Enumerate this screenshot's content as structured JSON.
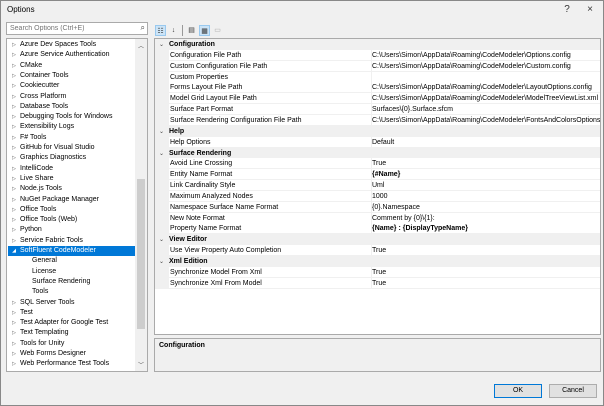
{
  "window": {
    "title": "Options",
    "help": "?",
    "close": "×"
  },
  "search": {
    "placeholder": "Search Options (Ctrl+E)"
  },
  "tree": [
    {
      "label": "Azure Dev Spaces Tools"
    },
    {
      "label": "Azure Service Authentication"
    },
    {
      "label": "CMake"
    },
    {
      "label": "Container Tools"
    },
    {
      "label": "Cookiecutter"
    },
    {
      "label": "Cross Platform"
    },
    {
      "label": "Database Tools"
    },
    {
      "label": "Debugging Tools for Windows"
    },
    {
      "label": "Extensibility Logs"
    },
    {
      "label": "F# Tools"
    },
    {
      "label": "GitHub for Visual Studio"
    },
    {
      "label": "Graphics Diagnostics"
    },
    {
      "label": "IntelliCode"
    },
    {
      "label": "Live Share"
    },
    {
      "label": "Node.js Tools"
    },
    {
      "label": "NuGet Package Manager"
    },
    {
      "label": "Office Tools"
    },
    {
      "label": "Office Tools (Web)"
    },
    {
      "label": "Python"
    },
    {
      "label": "Service Fabric Tools"
    },
    {
      "label": "SoftFluent CodeModeler",
      "expanded": true,
      "selected": true
    },
    {
      "label": "General",
      "child": true
    },
    {
      "label": "License",
      "child": true
    },
    {
      "label": "Surface Rendering",
      "child": true
    },
    {
      "label": "Tools",
      "child": true
    },
    {
      "label": "SQL Server Tools"
    },
    {
      "label": "Test"
    },
    {
      "label": "Test Adapter for Google Test"
    },
    {
      "label": "Text Templating"
    },
    {
      "label": "Tools for Unity"
    },
    {
      "label": "Web Forms Designer"
    },
    {
      "label": "Web Performance Test Tools"
    }
  ],
  "grid": [
    {
      "category": "Configuration"
    },
    {
      "name": "Configuration File Path",
      "value": "C:\\Users\\Simon\\AppData\\Roaming\\CodeModeler\\Options.config"
    },
    {
      "name": "Custom Configuration File Path",
      "value": "C:\\Users\\Simon\\AppData\\Roaming\\CodeModeler\\Custom.config"
    },
    {
      "name": "Custom Properties",
      "value": ""
    },
    {
      "name": "Forms Layout File Path",
      "value": "C:\\Users\\Simon\\AppData\\Roaming\\CodeModeler\\LayoutOptions.config"
    },
    {
      "name": "Model Grid Layout File Path",
      "value": "C:\\Users\\Simon\\AppData\\Roaming\\CodeModeler\\ModelTreeViewList.xml"
    },
    {
      "name": "Surface Part Format",
      "value": "Surfaces\\{0}.Surface.sfcm"
    },
    {
      "name": "Surface Rendering Configuration File Path",
      "value": "C:\\Users\\Simon\\AppData\\Roaming\\CodeModeler\\FontsAndColorsOptions"
    },
    {
      "category": "Help"
    },
    {
      "name": "Help Options",
      "value": "Default"
    },
    {
      "category": "Surface Rendering"
    },
    {
      "name": "Avoid Line Crossing",
      "value": "True"
    },
    {
      "name": "Entity Name Format",
      "value": "{#Name}",
      "bold": true
    },
    {
      "name": "Link Cardinality Style",
      "value": "Uml"
    },
    {
      "name": "Maximum Analyzed Nodes",
      "value": "1000"
    },
    {
      "name": "Namespace Surface Name Format",
      "value": "{0}.Namespace"
    },
    {
      "name": "New Note Format",
      "value": "Comment by {0}\\{1}:"
    },
    {
      "name": "Property Name Format",
      "value": "{Name} : {DisplayTypeName}",
      "bold": true
    },
    {
      "category": "View Editor"
    },
    {
      "name": "Use View Property Auto Completion",
      "value": "True"
    },
    {
      "category": "Xml Edition"
    },
    {
      "name": "Synchronize Model From Xml",
      "value": "True"
    },
    {
      "name": "Synchronize Xml From Model",
      "value": "True"
    }
  ],
  "description": {
    "title": "Configuration"
  },
  "buttons": {
    "ok": "OK",
    "cancel": "Cancel"
  }
}
